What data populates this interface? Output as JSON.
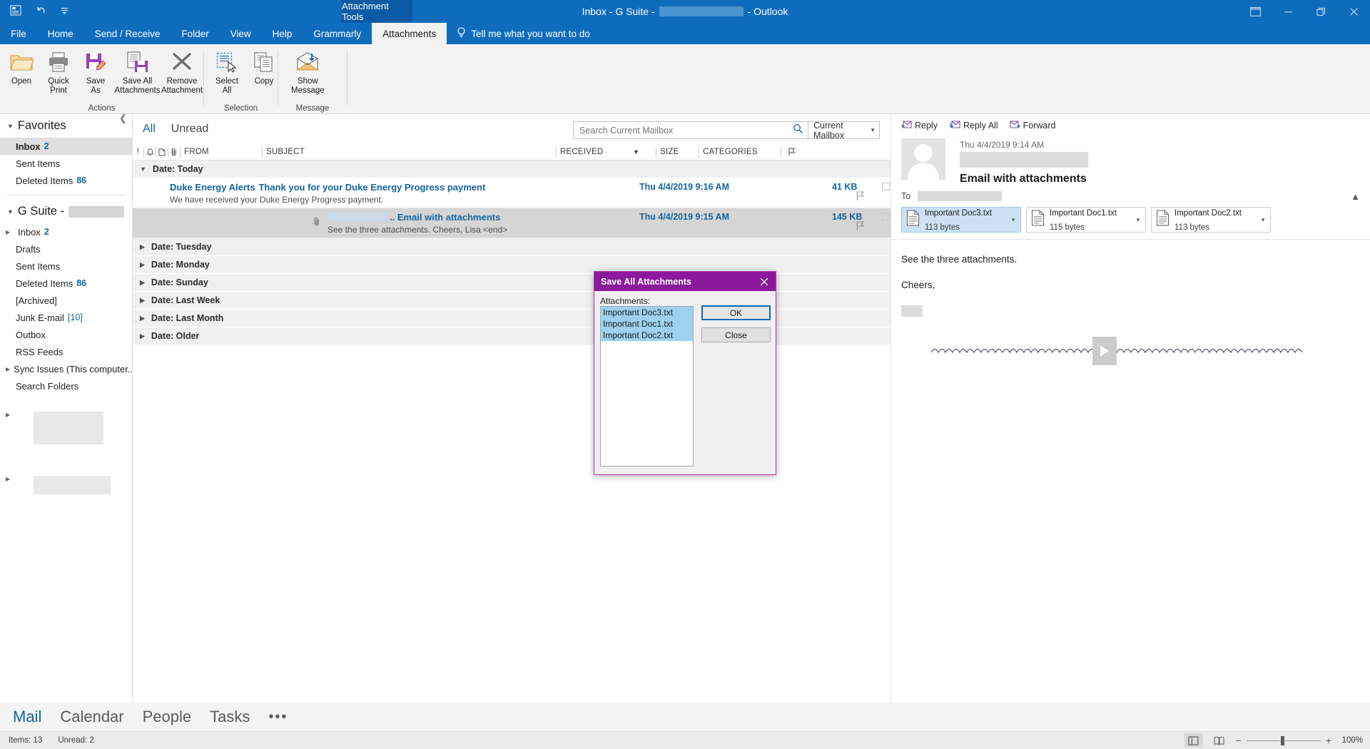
{
  "titlebar": {
    "title_prefix": "Inbox - G Suite -",
    "title_suffix": "- Outlook",
    "context_tab": "Attachment Tools",
    "quick_access": [
      "save-to-onedrive-icon",
      "undo-icon",
      "customize-qat-icon"
    ],
    "window_buttons": [
      "ribbon-display-options-icon",
      "minimize-icon",
      "restore-icon",
      "close-icon"
    ]
  },
  "ribbon": {
    "tabs": [
      {
        "label": "File",
        "active": false
      },
      {
        "label": "Home",
        "active": false
      },
      {
        "label": "Send / Receive",
        "active": false
      },
      {
        "label": "Folder",
        "active": false
      },
      {
        "label": "View",
        "active": false
      },
      {
        "label": "Help",
        "active": false
      },
      {
        "label": "Grammarly",
        "active": false
      },
      {
        "label": "Attachments",
        "active": true
      }
    ],
    "tell_me": "Tell me what you want to do",
    "groups": [
      {
        "name": "Actions",
        "buttons": [
          {
            "label": "Open",
            "icon": "folder-open-icon"
          },
          {
            "label": "Quick\nPrint",
            "icon": "printer-icon"
          },
          {
            "label": "Save\nAs",
            "icon": "save-as-icon"
          },
          {
            "label": "Save All\nAttachments",
            "icon": "save-all-attachments-icon"
          },
          {
            "label": "Remove\nAttachment",
            "icon": "remove-attachment-icon"
          }
        ]
      },
      {
        "name": "Selection",
        "buttons": [
          {
            "label": "Select\nAll",
            "icon": "select-all-icon"
          },
          {
            "label": "Copy",
            "icon": "copy-icon"
          }
        ]
      },
      {
        "name": "Message",
        "buttons": [
          {
            "label": "Show\nMessage",
            "icon": "show-message-icon"
          }
        ]
      }
    ]
  },
  "navpane": {
    "favorites": {
      "header": "Favorites",
      "items": [
        {
          "label": "Inbox",
          "count": "2",
          "selected": true
        },
        {
          "label": "Sent Items",
          "count": "",
          "selected": false
        },
        {
          "label": "Deleted Items",
          "count": "86",
          "selected": false
        }
      ]
    },
    "account": {
      "header": "G Suite -",
      "header_redacted": true,
      "items": [
        {
          "label": "Inbox",
          "count": "2",
          "twisty": true
        },
        {
          "label": "Drafts",
          "count": "",
          "twisty": false
        },
        {
          "label": "Sent Items",
          "count": "",
          "twisty": false
        },
        {
          "label": "Deleted Items",
          "count": "86",
          "twisty": false
        },
        {
          "label": "[Archived]",
          "count": "",
          "twisty": false
        },
        {
          "label": "Junk E-mail",
          "count": "[10]",
          "count_bracketed": true,
          "twisty": false
        },
        {
          "label": "Outbox",
          "count": "",
          "twisty": false
        },
        {
          "label": "RSS Feeds",
          "count": "",
          "twisty": false
        },
        {
          "label": "Sync Issues (This computer...",
          "count": "",
          "twisty": true
        },
        {
          "label": "Search Folders",
          "count": "",
          "twisty": false
        }
      ]
    }
  },
  "listpane": {
    "filters": [
      {
        "label": "All",
        "active": true
      },
      {
        "label": "Unread",
        "active": false
      }
    ],
    "search": {
      "placeholder": "Search Current Mailbox",
      "value": "",
      "icon": "search-icon",
      "scope": "Current Mailbox"
    },
    "columns": [
      "!",
      "reminder-icon",
      "page-icon",
      "paperclip-icon",
      "FROM",
      "SUBJECT",
      "RECEIVED",
      "SIZE",
      "CATEGORIES",
      "flag-icon"
    ],
    "groups": [
      {
        "label": "Date: Today",
        "expanded": true,
        "messages": [
          {
            "from": "Duke Energy Alerts",
            "subject": "Thank you for your Duke Energy Progress payment",
            "preview": "We have received your Duke Energy Progress payment.",
            "received": "Thu 4/4/2019 9:16 AM",
            "size": "41 KB",
            "selected": false,
            "attachment": false,
            "from_redacted": false
          },
          {
            "from": "",
            "from_redacted": true,
            "subject": ".. Email with attachments",
            "preview": "See the three attachments.  Cheers,  Lisa <end>",
            "received": "Thu 4/4/2019 9:15 AM",
            "size": "145 KB",
            "selected": true,
            "attachment": true
          }
        ]
      },
      {
        "label": "Date: Tuesday",
        "expanded": false,
        "messages": []
      },
      {
        "label": "Date: Monday",
        "expanded": false,
        "messages": []
      },
      {
        "label": "Date: Sunday",
        "expanded": false,
        "messages": []
      },
      {
        "label": "Date: Last Week",
        "expanded": false,
        "messages": []
      },
      {
        "label": "Date: Last Month",
        "expanded": false,
        "messages": []
      },
      {
        "label": "Date: Older",
        "expanded": false,
        "messages": []
      }
    ]
  },
  "readpane": {
    "actions": [
      {
        "label": "Reply",
        "icon": "reply-icon"
      },
      {
        "label": "Reply All",
        "icon": "reply-all-icon"
      },
      {
        "label": "Forward",
        "icon": "forward-icon"
      }
    ],
    "date": "Thu 4/4/2019 9:14 AM",
    "sender_redacted": true,
    "subject": "Email with attachments",
    "to_label": "To",
    "to_redacted": true,
    "attachments": [
      {
        "name": "Important Doc3.txt",
        "size": "113 bytes",
        "selected": true
      },
      {
        "name": "Important Doc1.txt",
        "size": "115 bytes",
        "selected": false
      },
      {
        "name": "Important Doc2.txt",
        "size": "113 bytes",
        "selected": false
      }
    ],
    "body": [
      "See the three attachments.",
      "Cheers,"
    ]
  },
  "dialog": {
    "title": "Save All Attachments",
    "close_icon": "close-icon",
    "label": "Attachments:",
    "items": [
      {
        "name": "Important Doc3.txt",
        "selected": true
      },
      {
        "name": "Important Doc1.txt",
        "selected": true
      },
      {
        "name": "Important Doc2.txt",
        "selected": true
      }
    ],
    "buttons": {
      "ok": "OK",
      "close": "Close"
    }
  },
  "modulebar": [
    {
      "label": "Mail",
      "active": true
    },
    {
      "label": "Calendar",
      "active": false
    },
    {
      "label": "People",
      "active": false
    },
    {
      "label": "Tasks",
      "active": false
    },
    {
      "label": "•••",
      "active": false
    }
  ],
  "statusbar": {
    "items_text": "Items: 13",
    "unread_text": "Unread: 2",
    "view_buttons": [
      "normal-view-icon",
      "reading-view-icon"
    ],
    "zoom": "100%"
  }
}
